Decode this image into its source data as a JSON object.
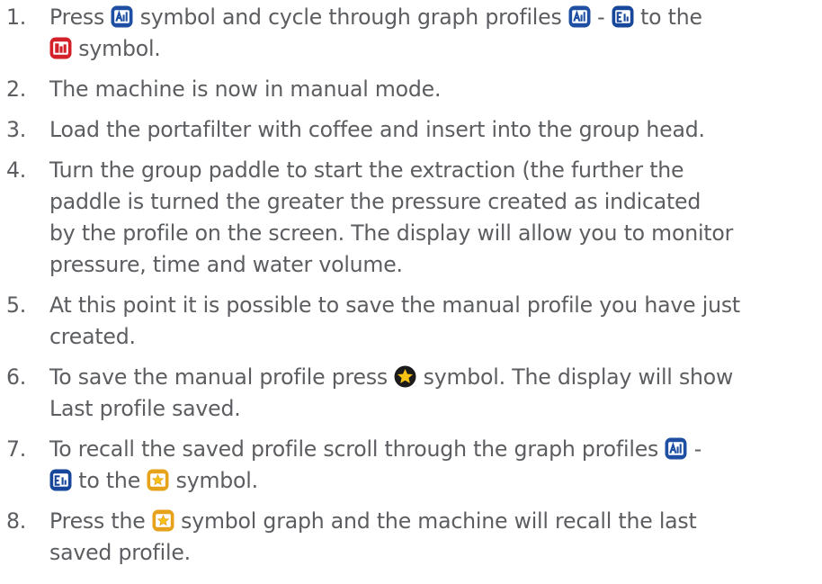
{
  "steps": [
    {
      "number": "1.",
      "lines": [
        [
          {
            "t": "Press "
          },
          {
            "icon": "graph-profile-a-icon"
          },
          {
            "t": " symbol and cycle through graph profiles "
          },
          {
            "icon": "graph-profile-a-icon"
          },
          {
            "t": " - "
          },
          {
            "icon": "graph-profile-e-icon"
          },
          {
            "t": " to the"
          }
        ],
        [
          {
            "icon": "manual-profile-icon"
          },
          {
            "t": " symbol."
          }
        ]
      ]
    },
    {
      "number": "2.",
      "lines": [
        [
          {
            "t": "The machine is now in manual mode."
          }
        ]
      ]
    },
    {
      "number": "3.",
      "lines": [
        [
          {
            "t": "Load the portafilter with coffee and insert into the group head."
          }
        ]
      ]
    },
    {
      "number": "4.",
      "lines": [
        [
          {
            "t": "Turn the group paddle to start the extraction (the further the"
          }
        ],
        [
          {
            "t": "paddle is turned the greater the pressure created as indicated"
          }
        ],
        [
          {
            "t": "by the profile on the screen. The display will allow you to monitor"
          }
        ],
        [
          {
            "t": "pressure, time and water volume."
          }
        ]
      ]
    },
    {
      "number": "5.",
      "lines": [
        [
          {
            "t": "At this point it is possible to save the manual profile you have just"
          }
        ],
        [
          {
            "t": "created."
          }
        ]
      ]
    },
    {
      "number": "6.",
      "lines": [
        [
          {
            "t": "To save the manual profile press "
          },
          {
            "icon": "star-save-icon"
          },
          {
            "t": " symbol. The display will show"
          }
        ],
        [
          {
            "t": "Last profile saved."
          }
        ]
      ]
    },
    {
      "number": "7.",
      "lines": [
        [
          {
            "t": "To recall the saved profile scroll through the graph profiles "
          },
          {
            "icon": "graph-profile-a-icon"
          },
          {
            "t": " -"
          }
        ],
        [
          {
            "icon": "graph-profile-e-icon"
          },
          {
            "t": " to the "
          },
          {
            "icon": "saved-profile-icon"
          },
          {
            "t": " symbol."
          }
        ]
      ]
    },
    {
      "number": "8.",
      "lines": [
        [
          {
            "t": "Press the "
          },
          {
            "icon": "saved-profile-icon"
          },
          {
            "t": " symbol graph and the machine will recall the last"
          }
        ],
        [
          {
            "t": "saved profile."
          }
        ]
      ]
    }
  ],
  "colors": {
    "text": "#5b5d60",
    "profile_a": "#1e4fa3",
    "profile_e": "#17479a",
    "manual": "#d32029",
    "saved": "#e6a21a",
    "star": "#f6c315"
  }
}
